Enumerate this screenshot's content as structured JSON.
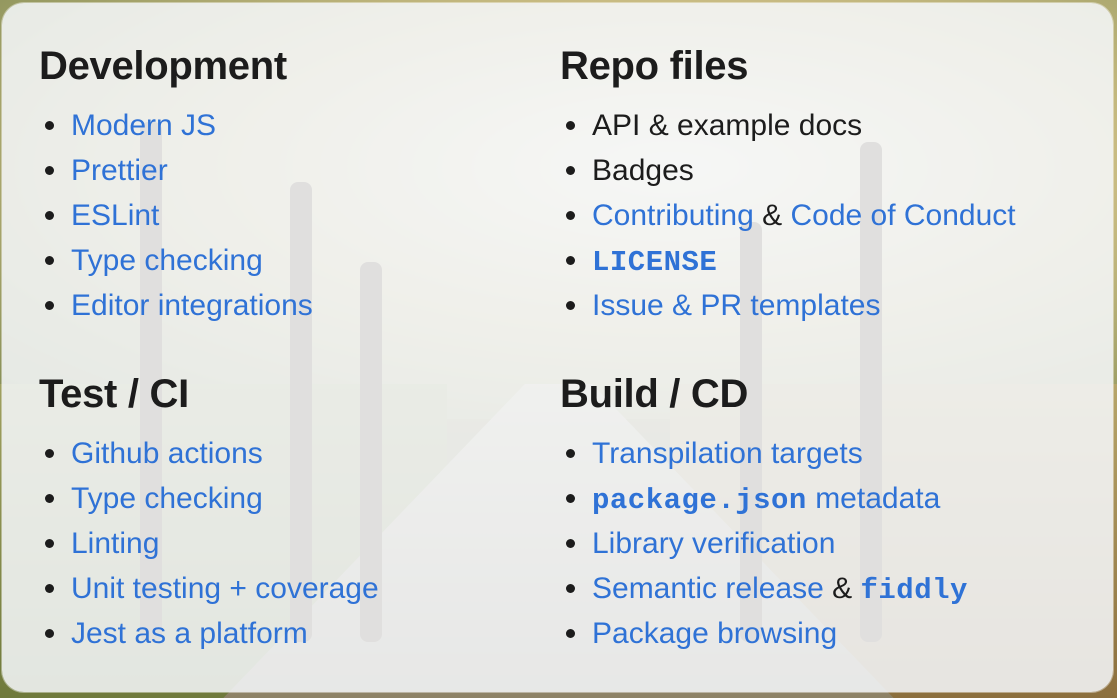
{
  "sections": {
    "development": {
      "title": "Development",
      "items": [
        "Modern JS",
        "Prettier",
        "ESLint",
        "Type checking",
        "Editor integrations"
      ]
    },
    "repo_files": {
      "title": "Repo files",
      "items": {
        "api_docs": "API & example docs",
        "badges": "Badges",
        "contributing": "Contributing",
        "amp": "&",
        "code_of_conduct": "Code of Conduct",
        "license": "LICENSE",
        "issue_templates": "Issue & PR templates"
      }
    },
    "test_ci": {
      "title": "Test / CI",
      "items": [
        "Github actions",
        "Type checking",
        "Linting",
        "Unit testing + coverage",
        "Jest as a platform"
      ]
    },
    "build_cd": {
      "title": "Build / CD",
      "items": {
        "transpilation": "Transpilation targets",
        "package_json": "package.json",
        "metadata": "metadata",
        "library_verification": "Library verification",
        "semantic_release": "Semantic release",
        "amp": "&",
        "fiddly": "fiddly",
        "package_browsing": "Package browsing"
      }
    }
  },
  "colors": {
    "link": "#2f72d6",
    "text": "#1c1c1c",
    "card": "#f6f8fc"
  }
}
